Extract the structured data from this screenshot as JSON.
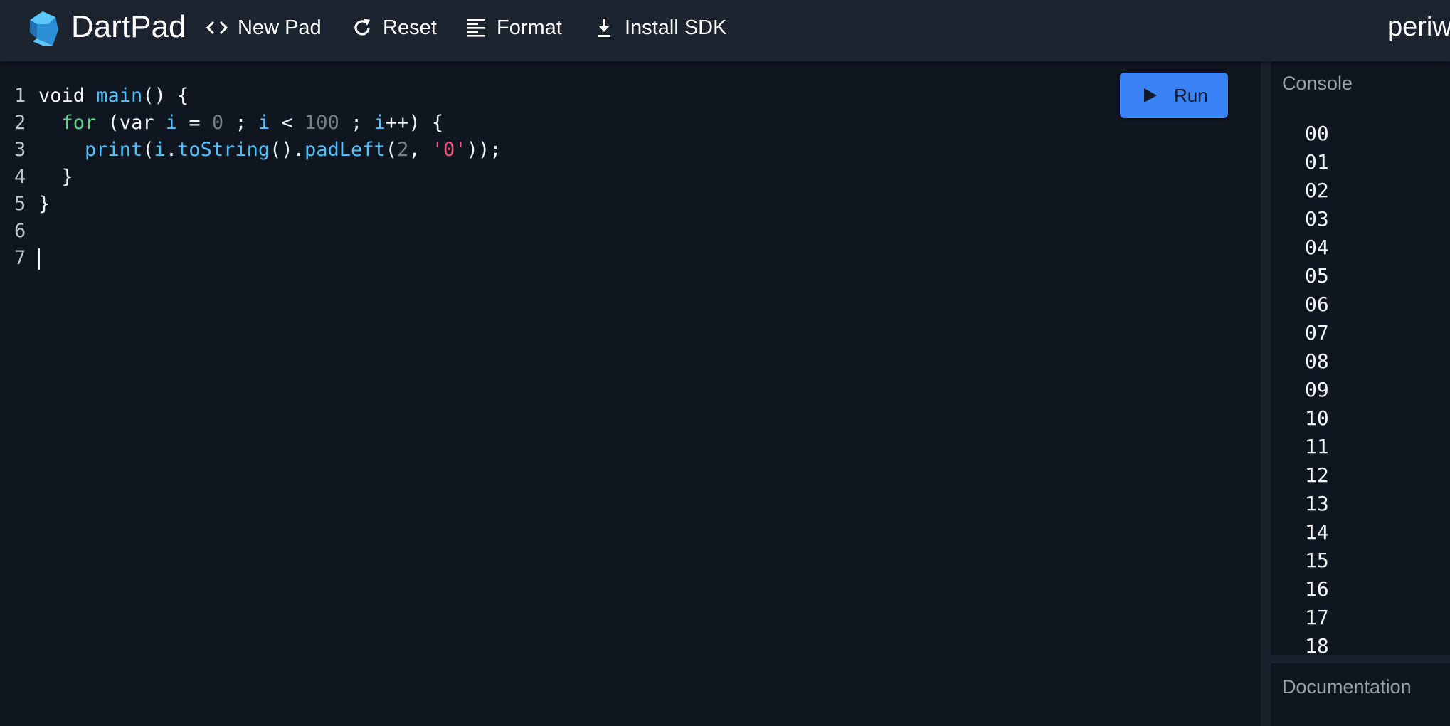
{
  "header": {
    "app_title": "DartPad",
    "buttons": [
      {
        "label": "New Pad",
        "icon": "code-brackets-icon"
      },
      {
        "label": "Reset",
        "icon": "refresh-icon"
      },
      {
        "label": "Format",
        "icon": "format-align-icon"
      },
      {
        "label": "Install SDK",
        "icon": "download-icon"
      }
    ],
    "user_label": "periw"
  },
  "editor": {
    "line_numbers": [
      "1",
      "2",
      "3",
      "4",
      "5",
      "6",
      "7"
    ],
    "code_lines": [
      "void main() {",
      "  for (var i = 0 ; i < 100 ; i++) {",
      "    print(i.toString().padLeft(2, '0'));",
      "  }",
      "}",
      "",
      ""
    ],
    "run_label": "Run"
  },
  "console": {
    "title": "Console",
    "lines": [
      "00",
      "01",
      "02",
      "03",
      "04",
      "05",
      "06",
      "07",
      "08",
      "09",
      "10",
      "11",
      "12",
      "13",
      "14",
      "15",
      "16",
      "17",
      "18"
    ]
  },
  "documentation": {
    "title": "Documentation"
  },
  "colors": {
    "topbar": "#1c2430",
    "background": "#0f1620",
    "run_button": "#3b82f6",
    "keyword": "#5cd18a",
    "identifier": "#4fc1ff",
    "number": "#7a7f86",
    "string": "#f0547a"
  }
}
